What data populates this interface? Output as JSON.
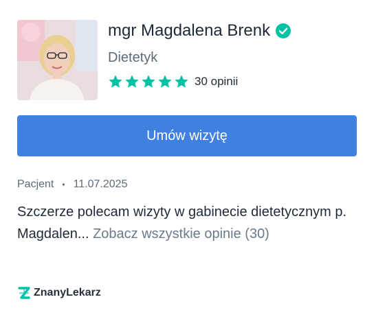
{
  "doctor": {
    "name": "mgr Magdalena Brenk",
    "specialty": "Dietetyk",
    "rating": 5,
    "reviews_count_label": "30 opinii"
  },
  "booking": {
    "button_label": "Umów wizytę"
  },
  "review": {
    "author": "Pacjent",
    "separator": "•",
    "date": "11.07.2025",
    "text": "Szczerze polecam wizyty w gabinecie dietetycznym p. Magdalen... ",
    "see_all_label": "Zobacz wszystkie opinie (30)"
  },
  "brand": {
    "name": "ZnanyLekarz"
  },
  "colors": {
    "accent": "#3f80e0",
    "star": "#00c3a5",
    "verified": "#00c3a5",
    "muted_text": "#5b6b7a",
    "link_text": "#6a7a89"
  },
  "icons": {
    "verified": "verified-check-icon",
    "star": "star-icon",
    "brand": "znanylekarz-logo-icon"
  }
}
